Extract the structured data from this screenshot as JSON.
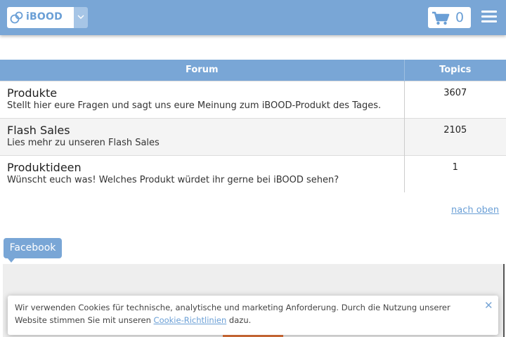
{
  "header": {
    "logo_text": "iBOOD",
    "cart_count": "0"
  },
  "forum_table": {
    "headers": {
      "forum": "Forum",
      "topics": "Topics"
    },
    "rows": [
      {
        "title": "Produkte",
        "description": "Stellt hier eure Fragen und sagt uns eure Meinung zum iBOOD-Produkt des Tages.",
        "topics": "3607"
      },
      {
        "title": "Flash Sales",
        "description": "Lies mehr zu unseren Flash Sales",
        "topics": "2105"
      },
      {
        "title": "Produktideen",
        "description": "Wünscht euch was! Welches Produkt würdet ihr gerne bei iBOOD sehen?",
        "topics": "1"
      }
    ]
  },
  "back_to_top": "nach oben",
  "facebook_tab": "Facebook",
  "cookie_notice": {
    "text_before": "Wir verwenden Cookies für technische, analytische und marketing Anforderung. Durch die Nutzung unserer Website stimmen Sie mit unseren ",
    "link": "Cookie-Richtlinien",
    "text_after": " dazu.",
    "close_symbol": "✕"
  },
  "colors": {
    "header_blue": "#79a6d6",
    "link_blue": "#6a9fd6",
    "button_orange": "#e0743a"
  }
}
